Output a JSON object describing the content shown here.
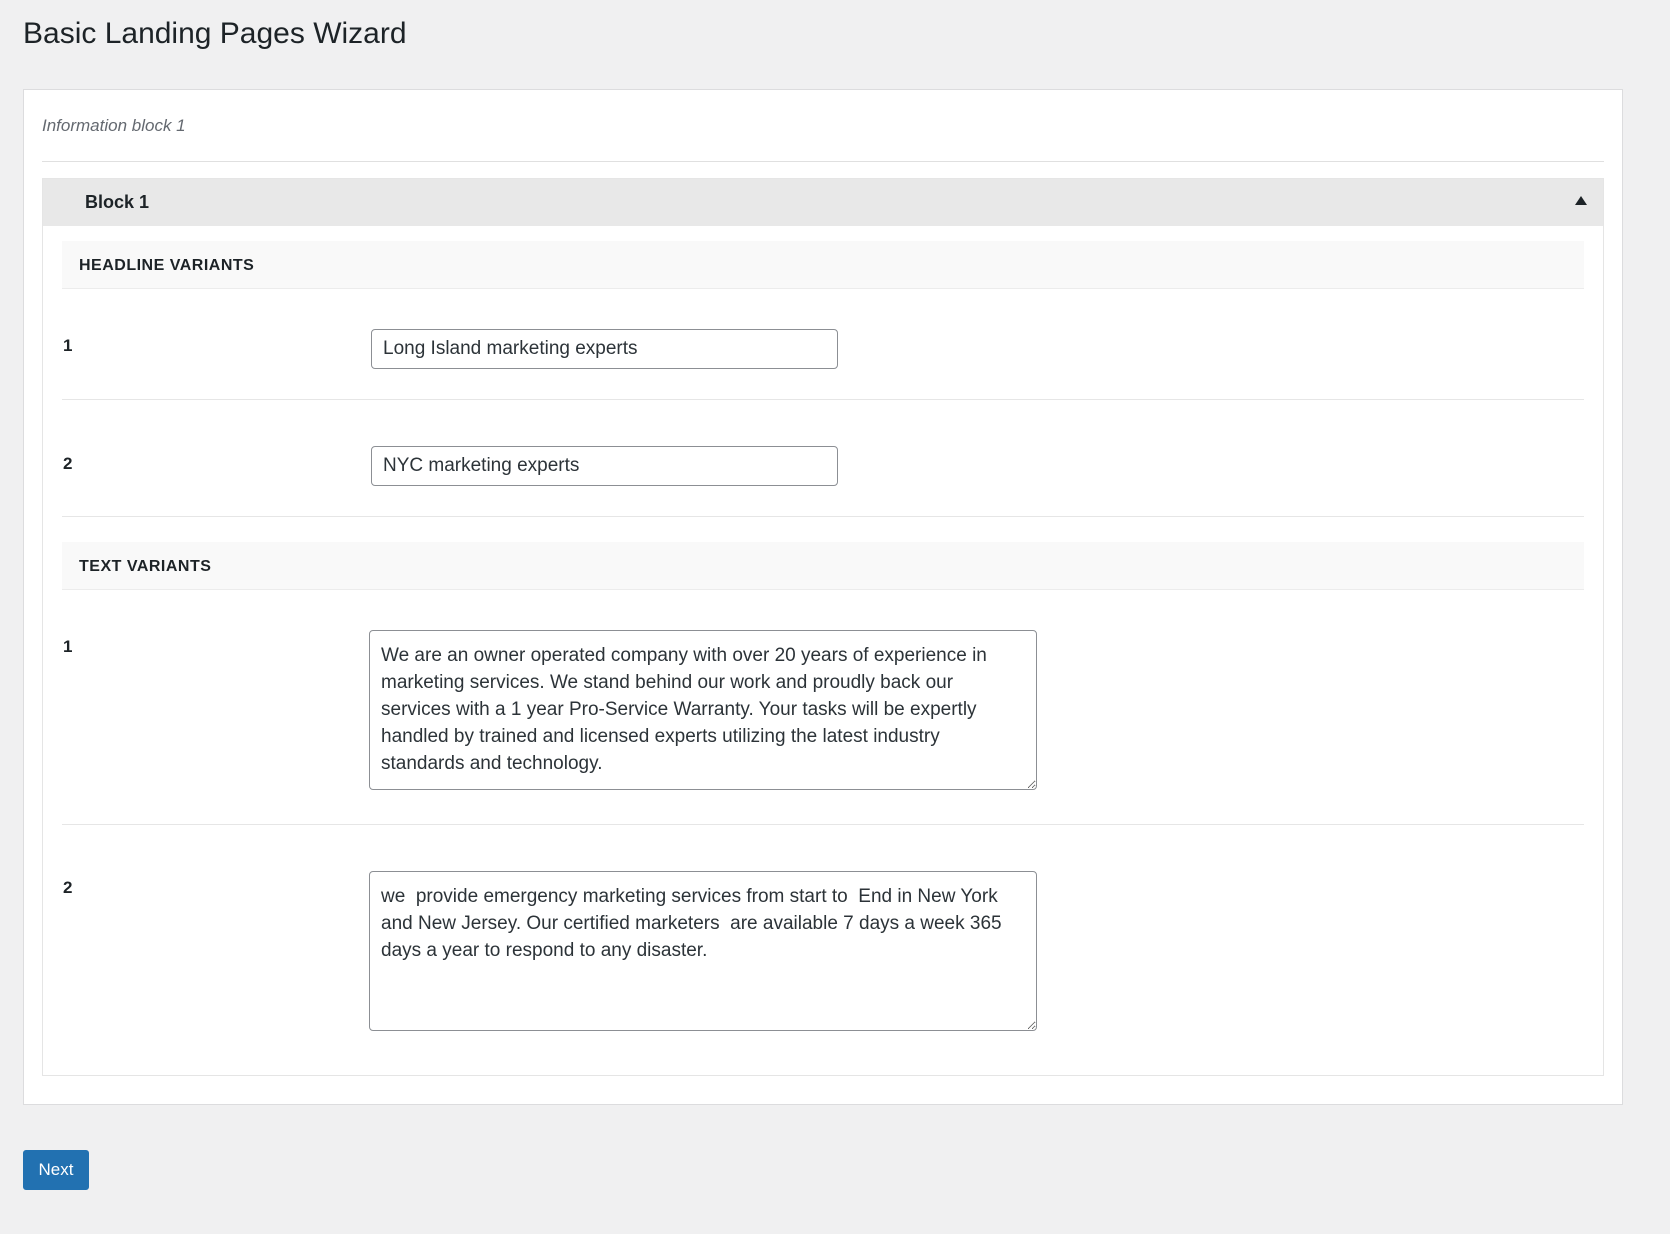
{
  "page": {
    "title": "Basic Landing Pages Wizard"
  },
  "section": {
    "caption": "Information block 1"
  },
  "block": {
    "title": "Block 1",
    "toggle_icon": "triangle-up-icon",
    "headline_group": {
      "heading": "HEADLINE VARIANTS",
      "rows": [
        {
          "number": "1",
          "value": "Long Island marketing experts"
        },
        {
          "number": "2",
          "value": "NYC marketing experts"
        }
      ]
    },
    "text_group": {
      "heading": "TEXT VARIANTS",
      "rows": [
        {
          "number": "1",
          "value": "We are an owner operated company with over 20 years of experience in marketing services. We stand behind our work and proudly back our services with a 1 year Pro-Service Warranty. Your tasks will be expertly handled by trained and licensed experts utilizing the latest industry standards and technology."
        },
        {
          "number": "2",
          "value": "we  provide emergency marketing services from start to  End in New York and New Jersey. Our certified marketers  are available 7 days a week 365 days a year to respond to any disaster."
        }
      ]
    }
  },
  "actions": {
    "next_label": "Next"
  },
  "colors": {
    "accent": "#2271b1",
    "background": "#f0f0f1",
    "block_header": "#e8e8e8"
  }
}
